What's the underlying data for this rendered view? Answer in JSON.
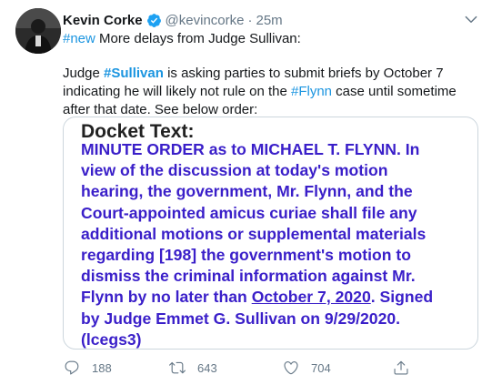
{
  "tweet": {
    "display_name": "Kevin Corke",
    "handle": "@kevincorke",
    "separator": "·",
    "time": "25m",
    "line1_hashtag": "#new",
    "line1_text": " More delays from Judge Sullivan:",
    "para_part1": "Judge ",
    "para_hashtag1": "#Sullivan",
    "para_part2": " is asking parties to submit briefs by October 7 indicating he will likely not rule on the ",
    "para_hashtag2": "#Flynn",
    "para_part3": " case until sometime after that date. See below order:"
  },
  "docket": {
    "title": "Docket Text:",
    "lines": [
      "MINUTE ORDER as to MICHAEL T. FLYNN. In",
      "view of the discussion at today's motion",
      "hearing, the government, Mr. Flynn, and the",
      "Court-appointed amicus curiae shall file any",
      "additional motions or supplemental materials",
      "regarding [198] the government's motion to",
      "dismiss the criminal information against Mr."
    ],
    "line8_pre": "Flynn by no later than ",
    "line8_date": "October 7, 2020",
    "line8_post": ". Signed",
    "line9": "by Judge Emmet G. Sullivan on 9/29/2020.",
    "line10": "(lcegs3)"
  },
  "actions": {
    "replies": "188",
    "retweets": "643",
    "likes": "704"
  },
  "colors": {
    "link": "#1b95e0",
    "muted": "#657786",
    "docket_text": "#3a1fc9",
    "verified": "#1da1f2"
  },
  "icons": {
    "verified": "verified-badge-icon",
    "caret": "chevron-down-icon",
    "reply": "reply-icon",
    "retweet": "retweet-icon",
    "like": "heart-icon",
    "share": "share-icon"
  }
}
